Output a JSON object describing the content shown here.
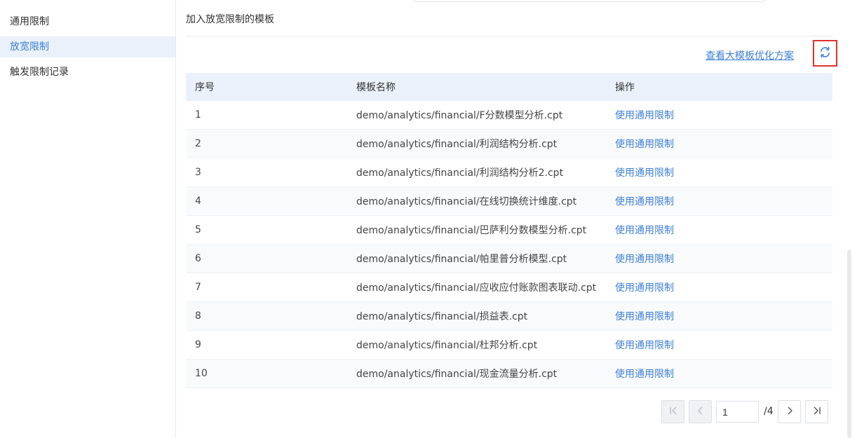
{
  "sidebar": {
    "items": [
      {
        "label": "通用限制"
      },
      {
        "label": "放宽限制"
      },
      {
        "label": "触发限制记录"
      }
    ]
  },
  "main": {
    "section_title": "加入放宽限制的模板",
    "optimize_link": "查看大模板优化方案",
    "refresh_icon": "refresh-icon",
    "table": {
      "headers": [
        "序号",
        "模板名称",
        "操作"
      ],
      "rows": [
        {
          "index": "1",
          "name": "demo/analytics/financial/F分数模型分析.cpt",
          "action": "使用通用限制"
        },
        {
          "index": "2",
          "name": "demo/analytics/financial/利润结构分析.cpt",
          "action": "使用通用限制"
        },
        {
          "index": "3",
          "name": "demo/analytics/financial/利润结构分析2.cpt",
          "action": "使用通用限制"
        },
        {
          "index": "4",
          "name": "demo/analytics/financial/在线切换统计维度.cpt",
          "action": "使用通用限制"
        },
        {
          "index": "5",
          "name": "demo/analytics/financial/巴萨利分数模型分析.cpt",
          "action": "使用通用限制"
        },
        {
          "index": "6",
          "name": "demo/analytics/financial/帕里普分析模型.cpt",
          "action": "使用通用限制"
        },
        {
          "index": "7",
          "name": "demo/analytics/financial/应收应付账款图表联动.cpt",
          "action": "使用通用限制"
        },
        {
          "index": "8",
          "name": "demo/analytics/financial/损益表.cpt",
          "action": "使用通用限制"
        },
        {
          "index": "9",
          "name": "demo/analytics/financial/杜邦分析.cpt",
          "action": "使用通用限制"
        },
        {
          "index": "10",
          "name": "demo/analytics/financial/现金流量分析.cpt",
          "action": "使用通用限制"
        }
      ]
    },
    "pagination": {
      "current_page": "1",
      "total_label": "/4"
    }
  },
  "colors": {
    "accent": "#3d7fd6",
    "highlight_border": "#e0312f",
    "header_bg": "#eaf1fa"
  }
}
